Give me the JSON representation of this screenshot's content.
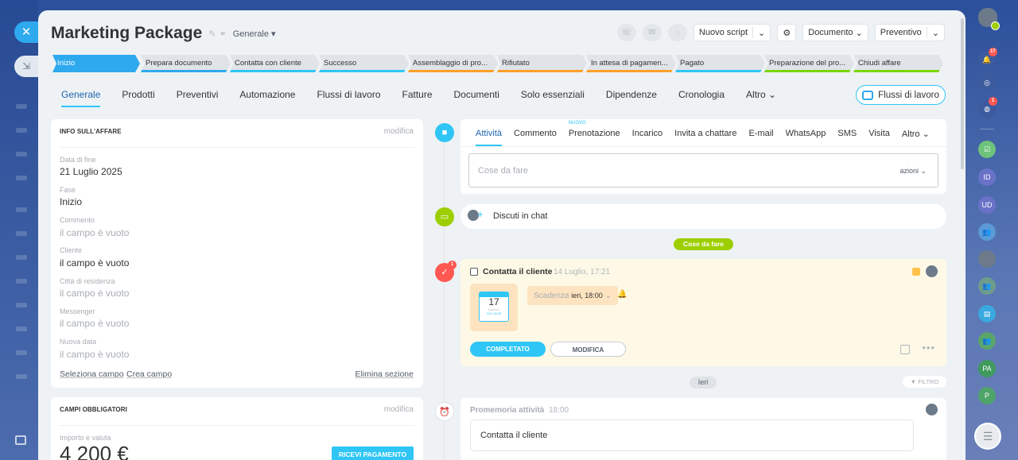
{
  "header": {
    "title": "Marketing Package",
    "category": "Generale",
    "script_btn": "Nuovo script",
    "document_btn": "Documento",
    "quote_btn": "Preventivo"
  },
  "stages": [
    {
      "label": "Inizio",
      "color": "#2fa9ee",
      "active": true
    },
    {
      "label": "Prepara documento",
      "color": "#2fa9ee"
    },
    {
      "label": "Contatta con cliente",
      "color": "#2fc6f6"
    },
    {
      "label": "Successo",
      "color": "#2fc6f6"
    },
    {
      "label": "Assemblaggio di pro...",
      "color": "#ff9f2a"
    },
    {
      "label": "Rifiutato",
      "color": "#ff9f2a"
    },
    {
      "label": "In attesa di pagamen...",
      "color": "#ff9f2a"
    },
    {
      "label": "Pagato",
      "color": "#2fc6f6"
    },
    {
      "label": "Preparazione del pro...",
      "color": "#7bd500"
    },
    {
      "label": "Chiudi affare",
      "color": "#7bd500"
    }
  ],
  "tabs": [
    "Generale",
    "Prodotti",
    "Preventivi",
    "Automazione",
    "Flussi di lavoro",
    "Fatture",
    "Documenti",
    "Solo essenziali",
    "Dipendenze",
    "Cronologia",
    "Altro"
  ],
  "flows_btn": "Flussi di lavoro",
  "info": {
    "title": "INFO SULL'AFFARE",
    "edit": "modifica",
    "fields": [
      {
        "label": "Data di fine",
        "value": "21 Luglio 2025",
        "empty": false
      },
      {
        "label": "Fase",
        "value": "Inizio",
        "empty": false
      },
      {
        "label": "Commento",
        "value": "il campo è vuoto",
        "empty": true
      },
      {
        "label": "Cliente",
        "value": "il campo è vuoto",
        "empty": false
      },
      {
        "label": "Città di residenza",
        "value": "il campo è vuoto",
        "empty": true
      },
      {
        "label": "Messenger",
        "value": "il campo è vuoto",
        "empty": true
      },
      {
        "label": "Nuova data",
        "value": "il campo è vuoto",
        "empty": true
      }
    ],
    "select_field": "Seleziona campo",
    "create_field": "Crea campo",
    "delete_section": "Elimina sezione"
  },
  "required": {
    "title": "CAMPI OBBLIGATORI",
    "edit": "modifica",
    "amount_label": "Importo e valuta",
    "amount_value": "4 200 €",
    "pay_btn": "RICEVI PAGAMENTO"
  },
  "activity": {
    "tabs": [
      "Attività",
      "Commento",
      "Prenotazione",
      "Incarico",
      "Invita a chattare",
      "E-mail",
      "WhatsApp",
      "SMS",
      "Visita",
      "Altro"
    ],
    "new_badge": "NUOVO",
    "todo_placeholder": "Cose da fare",
    "todo_actions": "azioni",
    "chat": "Discuti in chat",
    "todo_pill": "Cose da fare",
    "task": {
      "title": "Contatta il cliente",
      "date": "14 Luglio, 17:21",
      "cal_day": "17",
      "cal_month": "LUGLIO",
      "cal_time": "GIO 18:00",
      "deadline_label": "Scadenza",
      "deadline_value": "ieri, 18:00",
      "done_btn": "COMPLETATO",
      "edit_btn": "MODIFICA",
      "count": "1"
    },
    "yesterday": "Ieri",
    "filter": "FILTRO",
    "reminder": {
      "title": "Promemoria attività",
      "time": "18:00",
      "text": "Contatta il cliente"
    }
  },
  "rightbar": {
    "notif_count": "17",
    "chat_count": "1",
    "avatars": [
      "ID",
      "UD",
      "PA",
      "P"
    ]
  }
}
